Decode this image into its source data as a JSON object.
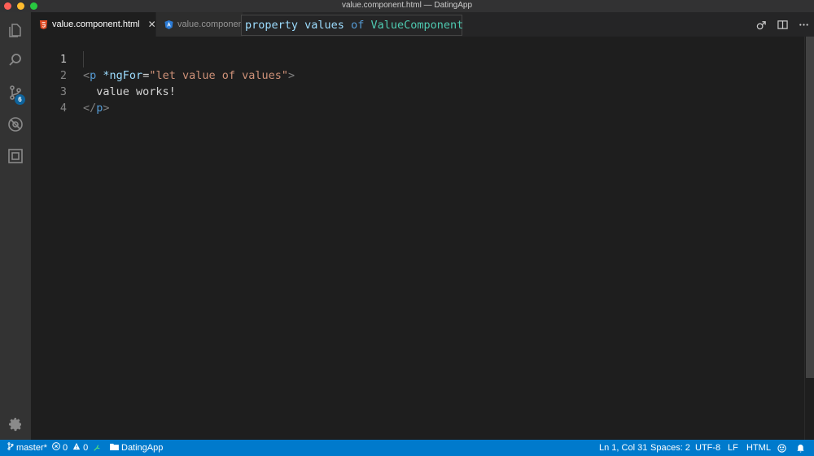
{
  "window": {
    "title": "value.component.html — DatingApp"
  },
  "activity": {
    "scm_badge": "6"
  },
  "tabs": [
    {
      "label": "value.component.html",
      "close": "✕"
    },
    {
      "label": "value.component.ts"
    }
  ],
  "editor": {
    "lines": [
      {
        "number": "1",
        "segments": [
          "<",
          "p",
          " ",
          "*ngFor",
          "=",
          "\"let value of values\"",
          ">"
        ]
      },
      {
        "number": "2",
        "text": "  value works!"
      },
      {
        "number": "3",
        "segments": [
          "</",
          "p",
          ">"
        ]
      },
      {
        "number": "4"
      }
    ]
  },
  "hover": {
    "kind": "property",
    "name": "values",
    "of": "of",
    "type": "ValueComponent"
  },
  "statusbar": {
    "branch": "master*",
    "errors": "0",
    "warnings": "0",
    "folder": "DatingApp",
    "position": "Ln 1, Col 31",
    "spaces": "Spaces: 2",
    "encoding": "UTF-8",
    "eol": "LF",
    "language": "HTML"
  },
  "colors": {
    "accent": "#007acc",
    "tag": "#569cd6",
    "attribute": "#9cdcfe",
    "string": "#ce9178"
  }
}
